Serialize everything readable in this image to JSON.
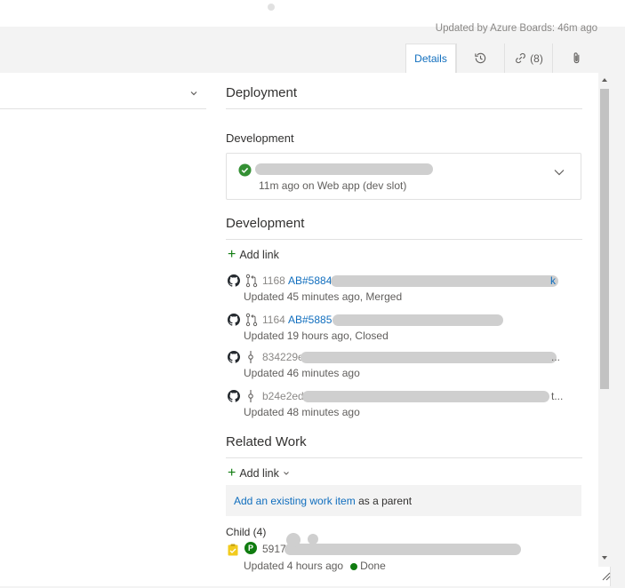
{
  "header": {
    "updated_text": "Updated by Azure Boards: 46m ago"
  },
  "tabs": [
    {
      "label": "Details",
      "icon": "details",
      "active": true
    },
    {
      "label": "",
      "icon": "history-icon"
    },
    {
      "label": "(8)",
      "icon": "link-icon"
    },
    {
      "label": "",
      "icon": "paperclip-icon"
    }
  ],
  "deployment": {
    "title": "Deployment",
    "subheading": "Development",
    "item_status": "11m ago on Web app (dev slot)"
  },
  "development": {
    "title": "Development",
    "add_link": "Add link",
    "items": [
      {
        "kind": "pull-request",
        "id": "1168",
        "ref": "AB#5884",
        "status": "Updated 45 minutes ago,  Merged"
      },
      {
        "kind": "pull-request",
        "id": "1164",
        "ref": "AB#5885",
        "status": "Updated 19 hours ago,  Closed"
      },
      {
        "kind": "commit",
        "id": "834229e",
        "ref": "",
        "status": "Updated 46 minutes ago"
      },
      {
        "kind": "commit",
        "id": "b24e2ed",
        "ref": "",
        "status": "Updated 48 minutes ago"
      }
    ]
  },
  "related": {
    "title": "Related Work",
    "add_link": "Add link",
    "parent_link": "Add an existing work item",
    "parent_suffix": " as a parent",
    "child_header": "Child (4)",
    "child": {
      "badge": "P",
      "id": "5917",
      "updated": "Updated 4 hours ago",
      "state": "Done"
    }
  },
  "colors": {
    "accent": "#106ebe",
    "success": "#107c10",
    "task": "#f2cb1d"
  }
}
